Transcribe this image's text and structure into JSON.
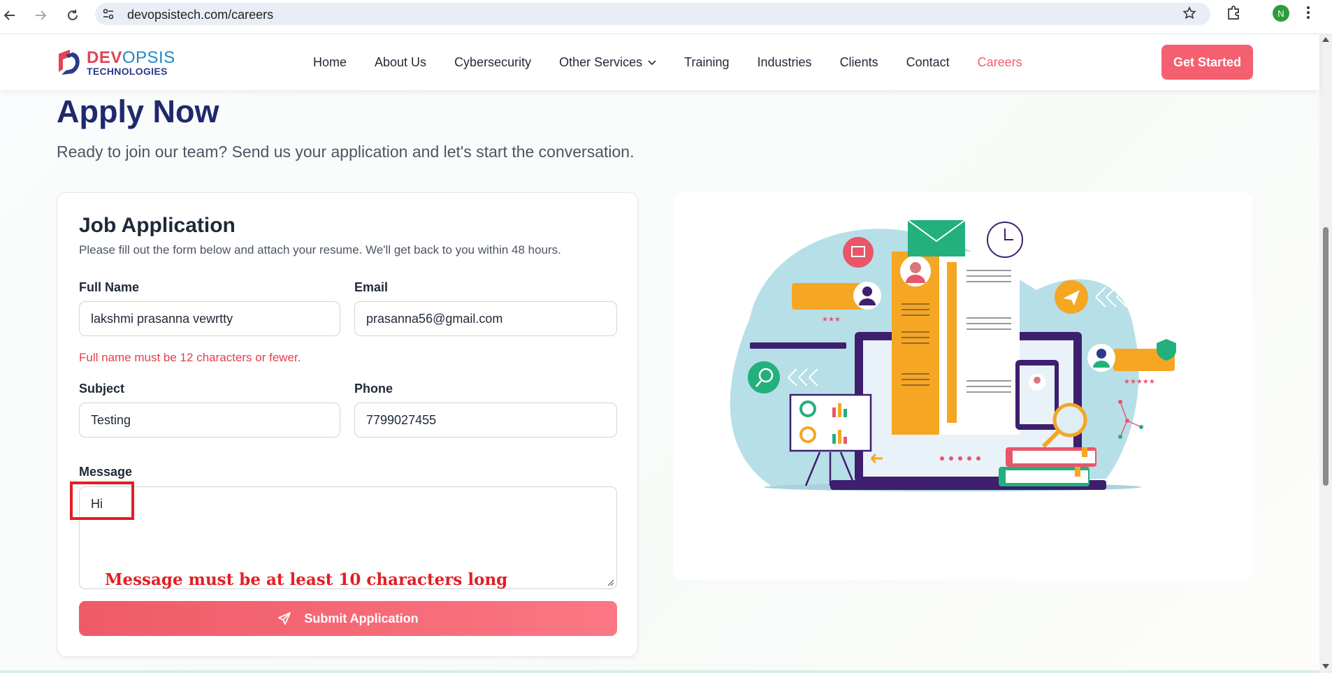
{
  "browser": {
    "url": "devopsistech.com/careers",
    "profile_initial": "N"
  },
  "header": {
    "logo": {
      "line1a": "DEV",
      "line1b": "OPSIS",
      "line2": "TECHNOLOGIES"
    },
    "nav": [
      {
        "label": "Home"
      },
      {
        "label": "About Us"
      },
      {
        "label": "Cybersecurity"
      },
      {
        "label": "Other Services"
      },
      {
        "label": "Training"
      },
      {
        "label": "Industries"
      },
      {
        "label": "Clients"
      },
      {
        "label": "Contact"
      },
      {
        "label": "Careers",
        "active": true
      }
    ],
    "cta_label": "Get Started"
  },
  "hero": {
    "title": "Apply Now",
    "subtitle": "Ready to join our team? Send us your application and let's start the conversation."
  },
  "form": {
    "title": "Job Application",
    "description": "Please fill out the form below and attach your resume. We'll get back to you within 48 hours.",
    "full_name": {
      "label": "Full Name",
      "value": "lakshmi prasanna vewrtty",
      "error": "Full name must be 12 characters or fewer."
    },
    "email": {
      "label": "Email",
      "value": "prasanna56@gmail.com"
    },
    "subject": {
      "label": "Subject",
      "value": "Testing"
    },
    "phone": {
      "label": "Phone",
      "value": "7799027455"
    },
    "message": {
      "label": "Message",
      "value": "Hi"
    },
    "annotation": "Message must be at least 10 characters long",
    "submit_label": "Submit Application"
  },
  "colors": {
    "accent": "#f4606f",
    "title": "#1e2a6b",
    "error": "#e53e4b",
    "annotation": "#e31e24"
  }
}
